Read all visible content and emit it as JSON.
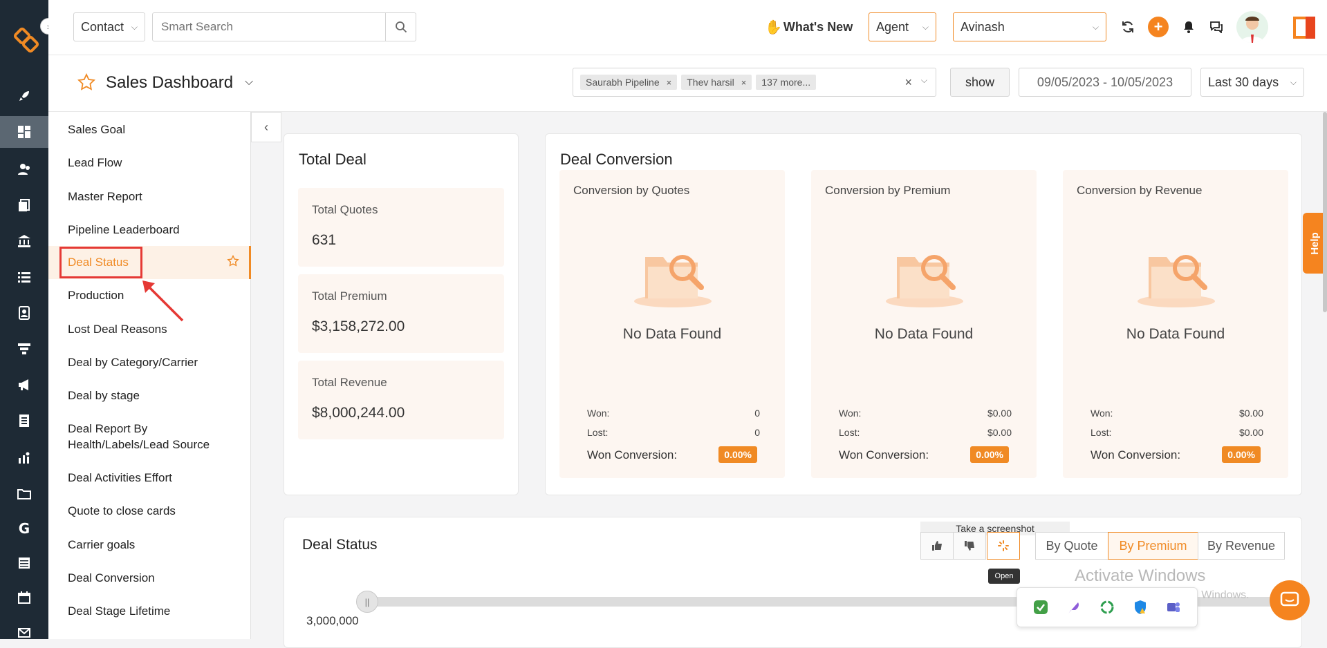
{
  "topbar": {
    "module_select": "Contact",
    "search_placeholder": "Smart Search",
    "whats_new": "What's New",
    "role_select": "Agent",
    "user_select": "Avinash"
  },
  "subheader": {
    "title": "Sales Dashboard",
    "filter_chips": [
      "Saurabh Pipeline",
      "Thev harsil",
      "137 more..."
    ],
    "show_label": "show",
    "date_range": "09/05/2023 - 10/05/2023",
    "period_select": "Last 30 days"
  },
  "menu": {
    "items": [
      "Sales Goal",
      "Lead Flow",
      "Master Report",
      "Pipeline Leaderboard",
      "Deal Status",
      "Production",
      "Lost Deal Reasons",
      "Deal by Category/Carrier",
      "Deal by stage",
      "Deal Report By Health/Labels/Lead Source",
      "Deal Activities Effort",
      "Quote to close cards",
      "Carrier goals",
      "Deal Conversion",
      "Deal Stage Lifetime"
    ]
  },
  "total_deal": {
    "title": "Total Deal",
    "stats": [
      {
        "label": "Total Quotes",
        "value": "631"
      },
      {
        "label": "Total Premium",
        "value": "$3,158,272.00"
      },
      {
        "label": "Total Revenue",
        "value": "$8,000,244.00"
      }
    ]
  },
  "deal_conversion": {
    "title": "Deal Conversion",
    "panels": [
      {
        "title": "Conversion by Quotes",
        "empty": "No Data Found",
        "won_label": "Won:",
        "won": "0",
        "lost_label": "Lost:",
        "lost": "0",
        "wc_label": "Won Conversion:",
        "wc": "0.00%"
      },
      {
        "title": "Conversion by Premium",
        "empty": "No Data Found",
        "won_label": "Won:",
        "won": "$0.00",
        "lost_label": "Lost:",
        "lost": "$0.00",
        "wc_label": "Won Conversion:",
        "wc": "0.00%"
      },
      {
        "title": "Conversion by Revenue",
        "empty": "No Data Found",
        "won_label": "Won:",
        "won": "$0.00",
        "lost_label": "Lost:",
        "lost": "$0.00",
        "wc_label": "Won Conversion:",
        "wc": "0.00%"
      }
    ]
  },
  "deal_status": {
    "title": "Deal Status",
    "tooltip_screenshot": "Take a screenshot",
    "tooltip_open": "Open",
    "segments": [
      "By Quote",
      "By Premium",
      "By Revenue"
    ],
    "axis_value": "3,000,000"
  },
  "overlay": {
    "help_label": "Help",
    "activate_title": "Activate Windows",
    "activate_sub": "Go to Settings to activate Windows."
  },
  "colors": {
    "accent": "#f08a24",
    "rail": "#1e2a35",
    "highlight_box": "#e53935"
  }
}
